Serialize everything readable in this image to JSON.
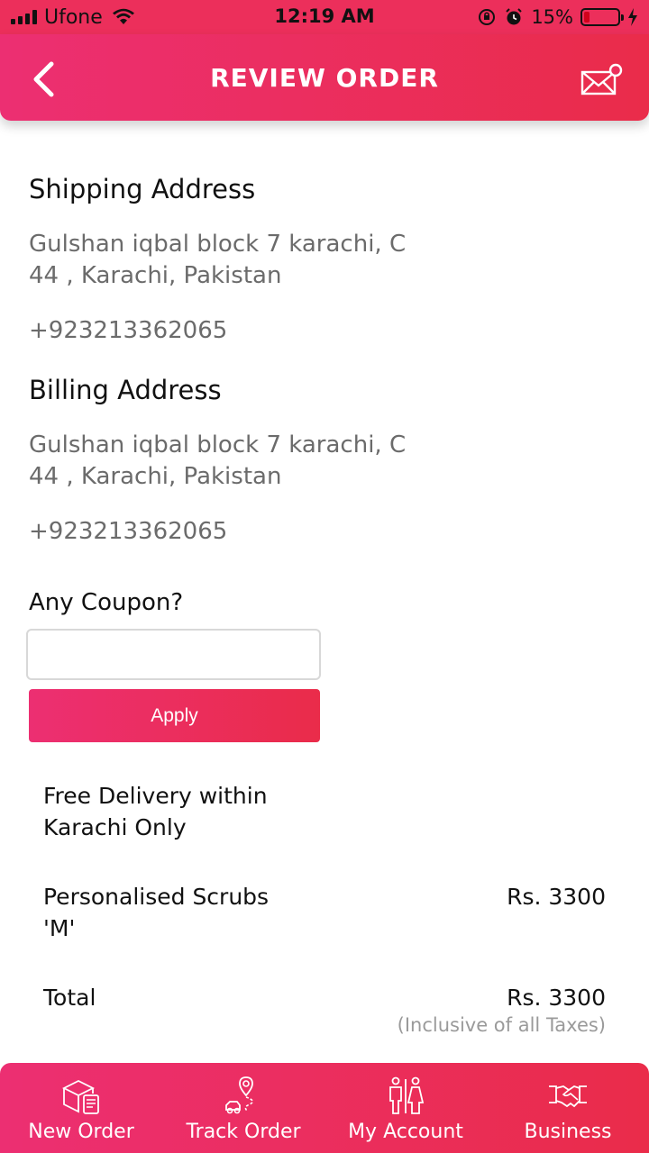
{
  "status_bar": {
    "carrier": "Ufone",
    "time": "12:19 AM",
    "battery_percent": "15%",
    "battery_level": 0.15,
    "icons": [
      "signal-icon",
      "wifi-icon",
      "orientation-lock-icon",
      "alarm-icon",
      "battery-icon",
      "charging-icon"
    ]
  },
  "header": {
    "title": "REVIEW ORDER",
    "back_icon": "chevron-left-icon",
    "mail_icon": "mail-notification-icon"
  },
  "shipping": {
    "heading": "Shipping Address",
    "address_line1": "Gulshan iqbal block 7 karachi, C",
    "address_line2": "44 , Karachi, Pakistan",
    "phone": "+923213362065"
  },
  "billing": {
    "heading": "Billing Address",
    "address_line1": "Gulshan iqbal block 7 karachi, C",
    "address_line2": "44 , Karachi, Pakistan",
    "phone": "+923213362065"
  },
  "coupon": {
    "label": "Any Coupon?",
    "value": "",
    "apply_label": "Apply"
  },
  "order": {
    "free_delivery_line1": "Free Delivery within",
    "free_delivery_line2": "Karachi Only",
    "item_name_line1": "Personalised Scrubs",
    "item_name_line2": "'M'",
    "item_price": "Rs. 3300",
    "total_label": "Total",
    "total_price": "Rs. 3300",
    "tax_note": "(Inclusive of all Taxes)"
  },
  "bottom_nav": {
    "items": [
      {
        "label": "New Order",
        "icon": "package-icon"
      },
      {
        "label": "Track Order",
        "icon": "delivery-location-icon"
      },
      {
        "label": "My Account",
        "icon": "people-icon"
      },
      {
        "label": "Business",
        "icon": "handshake-icon"
      }
    ]
  },
  "colors": {
    "brand": "#ec2f5b",
    "text_primary": "#111111",
    "text_secondary": "#6b6b6b"
  }
}
